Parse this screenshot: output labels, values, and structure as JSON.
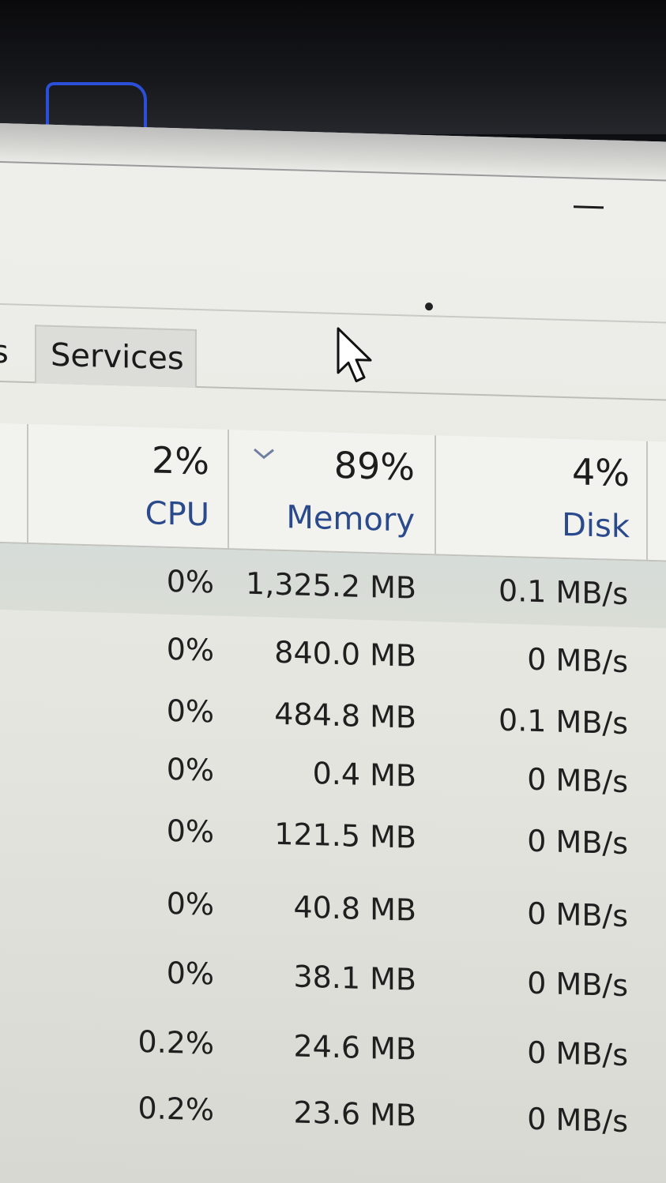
{
  "tabs": {
    "partial_label": "s",
    "services_label": "Services"
  },
  "header": {
    "cpu": {
      "percent": "2%",
      "label": "CPU"
    },
    "memory": {
      "percent": "89%",
      "label": "Memory"
    },
    "disk": {
      "percent": "4%",
      "label": "Disk"
    },
    "sorted_column": "Memory",
    "sort_direction": "descending"
  },
  "rows": [
    {
      "cpu": "0%",
      "memory": "1,325.2 MB",
      "disk": "0.1 MB/s"
    },
    {
      "cpu": "0%",
      "memory": "840.0 MB",
      "disk": "0 MB/s"
    },
    {
      "cpu": "0%",
      "memory": "484.8 MB",
      "disk": "0.1 MB/s"
    },
    {
      "cpu": "0%",
      "memory": "0.4 MB",
      "disk": "0 MB/s"
    },
    {
      "cpu": "0%",
      "memory": "121.5 MB",
      "disk": "0 MB/s"
    },
    {
      "cpu": "0%",
      "memory": "40.8 MB",
      "disk": "0 MB/s"
    },
    {
      "cpu": "0%",
      "memory": "38.1 MB",
      "disk": "0 MB/s"
    },
    {
      "cpu": "0.2%",
      "memory": "24.6 MB",
      "disk": "0 MB/s"
    },
    {
      "cpu": "0.2%",
      "memory": "23.6 MB",
      "disk": "0 MB/s"
    }
  ],
  "icons": {
    "minimize": "minimize-icon",
    "cursor": "mouse-pointer-icon",
    "sort": "chevron-down-icon"
  },
  "colors": {
    "header_label": "#2a4a8c",
    "taskbar_accent": "#2b4fd8"
  }
}
